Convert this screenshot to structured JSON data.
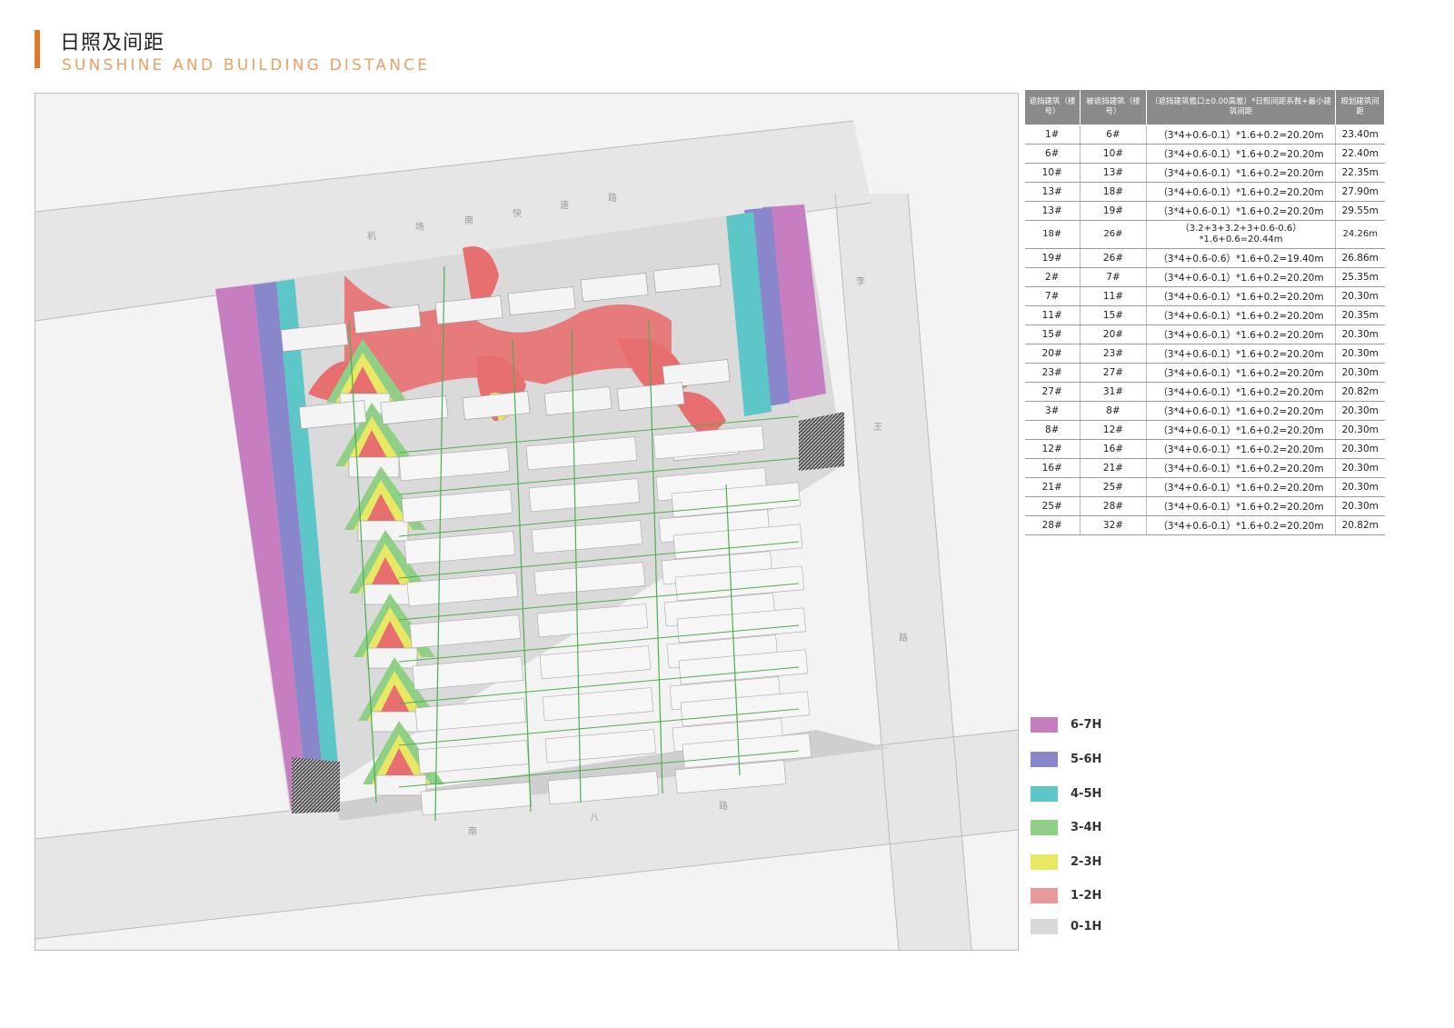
{
  "header": {
    "title_cn": "日照及间距",
    "title_en": "SUNSHINE AND BUILDING DISTANCE"
  },
  "map": {
    "road_labels": [
      "机",
      "场",
      "南",
      "快",
      "速",
      "路",
      "李",
      "王",
      "路",
      "南",
      "八",
      "路"
    ]
  },
  "table": {
    "headers": [
      "遮挡建筑（楼号）",
      "被遮挡建筑（楼号）",
      "（遮挡建筑檐口±0.00高差）*日照间距系数+最小建筑间距",
      "规划建筑间距"
    ],
    "rows": [
      [
        "1#",
        "6#",
        "（3*4+0.6-0.1）*1.6+0.2=20.20m",
        "23.40m"
      ],
      [
        "6#",
        "10#",
        "（3*4+0.6-0.1）*1.6+0.2=20.20m",
        "22.40m"
      ],
      [
        "10#",
        "13#",
        "（3*4+0.6-0.1）*1.6+0.2=20.20m",
        "22.35m"
      ],
      [
        "13#",
        "18#",
        "（3*4+0.6-0.1）*1.6+0.2=20.20m",
        "27.90m"
      ],
      [
        "13#",
        "19#",
        "（3*4+0.6-0.1）*1.6+0.2=20.20m",
        "29.55m"
      ],
      [
        "18#",
        "26#",
        "（3.2+3+3.2+3+0.6-0.6）*1.6+0.6=20.44m",
        "24.26m"
      ],
      [
        "19#",
        "26#",
        "（3*4+0.6-0.6）*1.6+0.2=19.40m",
        "26.86m"
      ],
      [
        "2#",
        "7#",
        "（3*4+0.6-0.1）*1.6+0.2=20.20m",
        "25.35m"
      ],
      [
        "7#",
        "11#",
        "（3*4+0.6-0.1）*1.6+0.2=20.20m",
        "20.30m"
      ],
      [
        "11#",
        "15#",
        "（3*4+0.6-0.1）*1.6+0.2=20.20m",
        "20.35m"
      ],
      [
        "15#",
        "20#",
        "（3*4+0.6-0.1）*1.6+0.2=20.20m",
        "20.30m"
      ],
      [
        "20#",
        "23#",
        "（3*4+0.6-0.1）*1.6+0.2=20.20m",
        "20.30m"
      ],
      [
        "23#",
        "27#",
        "（3*4+0.6-0.1）*1.6+0.2=20.20m",
        "20.30m"
      ],
      [
        "27#",
        "31#",
        "（3*4+0.6-0.1）*1.6+0.2=20.20m",
        "20.82m"
      ],
      [
        "3#",
        "8#",
        "（3*4+0.6-0.1）*1.6+0.2=20.20m",
        "20.30m"
      ],
      [
        "8#",
        "12#",
        "（3*4+0.6-0.1）*1.6+0.2=20.20m",
        "20.30m"
      ],
      [
        "12#",
        "16#",
        "（3*4+0.6-0.1）*1.6+0.2=20.20m",
        "20.30m"
      ],
      [
        "16#",
        "21#",
        "（3*4+0.6-0.1）*1.6+0.2=20.20m",
        "20.30m"
      ],
      [
        "21#",
        "25#",
        "（3*4+0.6-0.1）*1.6+0.2=20.20m",
        "20.30m"
      ],
      [
        "25#",
        "28#",
        "（3*4+0.6-0.1）*1.6+0.2=20.20m",
        "20.30m"
      ],
      [
        "28#",
        "32#",
        "（3*4+0.6-0.1）*1.6+0.2=20.20m",
        "20.82m"
      ]
    ]
  },
  "legend": [
    {
      "label": "6-7H",
      "color": "#c77ec0"
    },
    {
      "label": "5-6H",
      "color": "#8a86cc"
    },
    {
      "label": "4-5H",
      "color": "#5cc6c8"
    },
    {
      "label": "3-4H",
      "color": "#8fcf86"
    },
    {
      "label": "2-3H",
      "color": "#e8e865"
    },
    {
      "label": "1-2H",
      "color": "#e89a9a"
    },
    {
      "label": "0-1H",
      "color": "#d8d8d8"
    }
  ]
}
